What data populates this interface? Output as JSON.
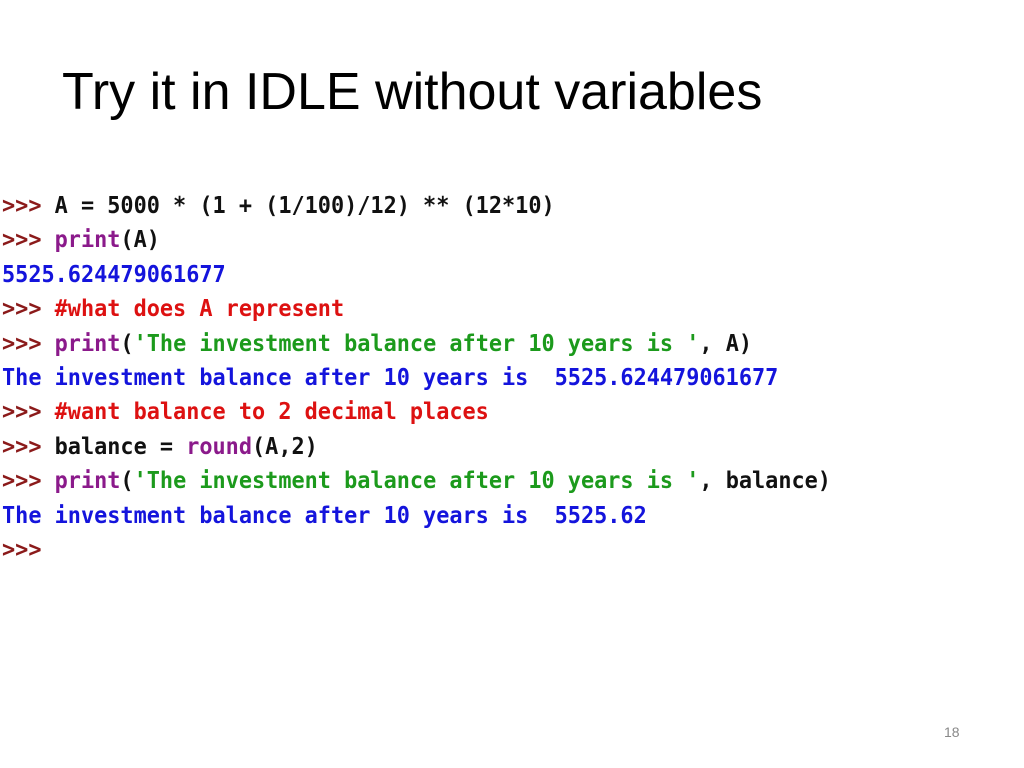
{
  "slide": {
    "title": "Try it in IDLE without variables",
    "page_number": "18"
  },
  "colors": {
    "prompt": "#8b1a1a",
    "code": "#111111",
    "builtin": "#8b1a8b",
    "string": "#1c9a1c",
    "comment": "#dd1111",
    "output": "#1414dc"
  },
  "shell": {
    "lines": [
      {
        "prompt": ">>> ",
        "parts": [
          {
            "t": "code",
            "v": "A = 5000 * (1 + (1/100)/12) ** (12*10)"
          }
        ]
      },
      {
        "prompt": ">>> ",
        "parts": [
          {
            "t": "builtin",
            "v": "print"
          },
          {
            "t": "code",
            "v": "(A)"
          }
        ]
      },
      {
        "prompt": "",
        "parts": [
          {
            "t": "output",
            "v": "5525.624479061677"
          }
        ]
      },
      {
        "prompt": ">>> ",
        "parts": [
          {
            "t": "comment",
            "v": "#what does A represent"
          }
        ]
      },
      {
        "prompt": ">>> ",
        "parts": [
          {
            "t": "builtin",
            "v": "print"
          },
          {
            "t": "code",
            "v": "("
          },
          {
            "t": "string",
            "v": "'The investment balance after 10 years is '"
          },
          {
            "t": "code",
            "v": ", A)"
          }
        ]
      },
      {
        "prompt": "",
        "parts": [
          {
            "t": "output",
            "v": "The investment balance after 10 years is  5525.624479061677"
          }
        ]
      },
      {
        "prompt": ">>> ",
        "parts": [
          {
            "t": "comment",
            "v": "#want balance to 2 decimal places"
          }
        ]
      },
      {
        "prompt": ">>> ",
        "parts": [
          {
            "t": "code",
            "v": "balance = "
          },
          {
            "t": "builtin",
            "v": "round"
          },
          {
            "t": "code",
            "v": "(A,2)"
          }
        ]
      },
      {
        "prompt": ">>> ",
        "parts": [
          {
            "t": "builtin",
            "v": "print"
          },
          {
            "t": "code",
            "v": "("
          },
          {
            "t": "string",
            "v": "'The investment balance after 10 years is '"
          },
          {
            "t": "code",
            "v": ", balance)"
          }
        ]
      },
      {
        "prompt": "",
        "parts": [
          {
            "t": "output",
            "v": "The investment balance after 10 years is  5525.62"
          }
        ]
      },
      {
        "prompt": ">>>",
        "parts": []
      }
    ]
  }
}
